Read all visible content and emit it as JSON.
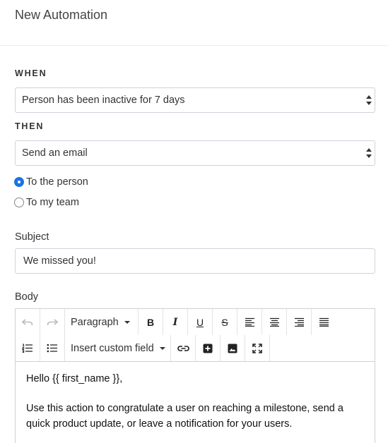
{
  "header": {
    "title": "New Automation"
  },
  "when": {
    "label": "WHEN",
    "selected": "Person has been inactive for 7 days"
  },
  "then": {
    "label": "THEN",
    "selected": "Send an email",
    "recipients": [
      {
        "label": "To the person",
        "checked": true
      },
      {
        "label": "To my team",
        "checked": false
      }
    ]
  },
  "subject": {
    "label": "Subject",
    "value": "We missed you!"
  },
  "body": {
    "label": "Body",
    "toolbar": {
      "block_format": "Paragraph",
      "custom_field": "Insert custom field",
      "bold": "B",
      "italic": "I",
      "underline": "U",
      "strikethrough": "S"
    },
    "paragraphs": [
      "Hello {{ first_name }},",
      "Use this action to congratulate a user on reaching a milestone, send a quick product update, or leave a notification for your users."
    ]
  },
  "colors": {
    "accent": "#1a73e8",
    "border": "#ced4da"
  }
}
